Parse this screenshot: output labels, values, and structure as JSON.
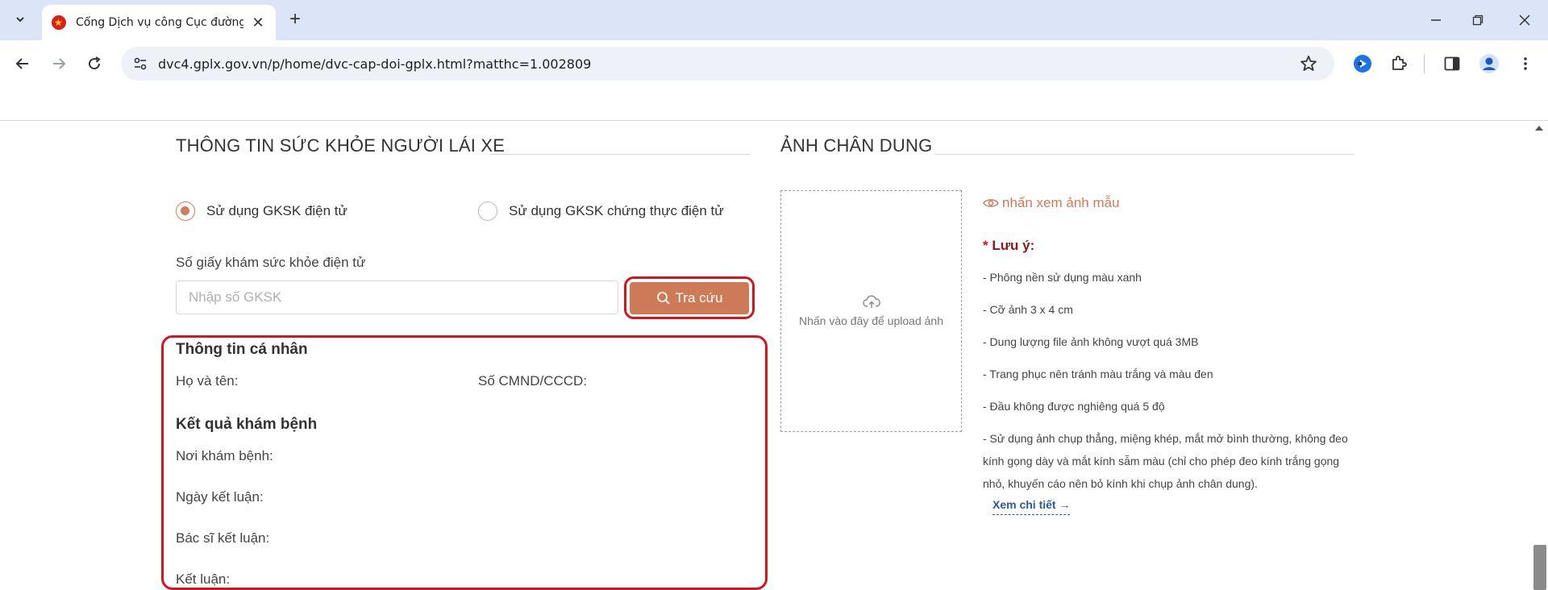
{
  "browser": {
    "tab_title": "Cổng Dịch vụ công Cục đường",
    "url": "dvc4.gplx.gov.vn/p/home/dvc-cap-doi-gplx.html?matthc=1.002809"
  },
  "health": {
    "title": "THÔNG TIN SỨC KHỎE NGƯỜI LÁI XE",
    "radio_electronic": "Sử dụng GKSK điện tử",
    "radio_certified": "Sử dụng GKSK chứng thực điện tử",
    "field_label": "Số giấy khám sức khỏe điện tử",
    "field_placeholder": "Nhập số GKSK",
    "field_value": "",
    "search_label": "Tra cứu"
  },
  "personal": {
    "title": "Thông tin cá nhân",
    "name_label": "Họ và tên:",
    "id_label": "Số CMND/CCCD:"
  },
  "result": {
    "title": "Kết quả khám bệnh",
    "place_label": "Nơi khám bệnh:",
    "date_label": "Ngày kết luận:",
    "doctor_label": "Bác sĩ kết luận:",
    "conclusion_label": "Kết luận:"
  },
  "portrait": {
    "title": "ẢNH CHÂN DUNG",
    "upload_text": "Nhấn vào đây để upload ảnh",
    "sample_link": "nhấn xem ảnh mẫu",
    "note_asterisk": "*",
    "note_title": "Lưu ý:",
    "notes": [
      "- Phông nền sử dụng màu xanh",
      "- Cỡ ảnh 3 x 4 cm",
      "- Dung lượng file ảnh không vượt quá 3MB",
      "- Trang phục nên tránh màu trắng và màu đen",
      "- Đầu không được nghiêng quá 5 độ",
      "- Sử dụng ảnh chụp thẳng, miệng khép, mắt mở bình thường, không đeo kính gọng dày và mắt kính sẫm màu (chỉ cho phép đeo kính trắng gọng nhỏ, khuyến cáo nên bỏ kính khi chụp ảnh chân dung)."
    ],
    "detail_link": "Xem chi tiết →"
  },
  "colors": {
    "accent": "#cf7a57",
    "highlight": "#d4151f",
    "note_title": "#8b1a1a",
    "link": "#2c5aa0"
  }
}
